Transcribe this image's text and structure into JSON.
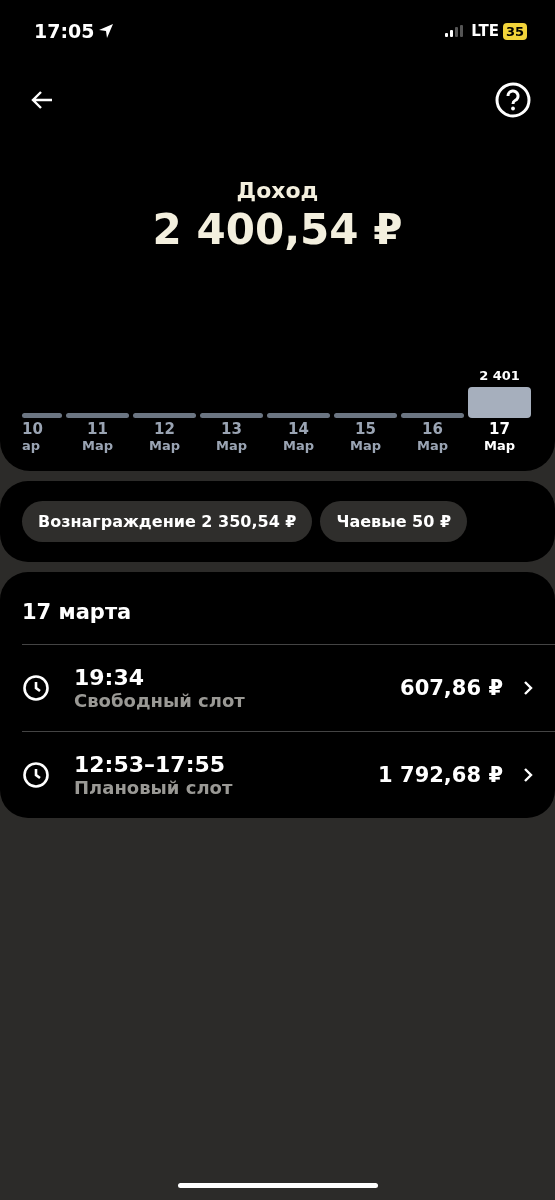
{
  "status_bar": {
    "time": "17:05",
    "network": "LTE",
    "battery": "35"
  },
  "header": {
    "title": "Доход",
    "amount": "2 400,54 ₽"
  },
  "days": [
    {
      "day": "10",
      "month": "ар",
      "selected": false
    },
    {
      "day": "11",
      "month": "Мар",
      "selected": false
    },
    {
      "day": "12",
      "month": "Мар",
      "selected": false
    },
    {
      "day": "13",
      "month": "Мар",
      "selected": false
    },
    {
      "day": "14",
      "month": "Мар",
      "selected": false
    },
    {
      "day": "15",
      "month": "Мар",
      "selected": false
    },
    {
      "day": "16",
      "month": "Мар",
      "selected": false
    },
    {
      "day": "17",
      "month": "Мар",
      "selected": true,
      "value": "2 401"
    }
  ],
  "chips": [
    "Вознаграждение 2 350,54 ₽",
    "Чаевые 50 ₽"
  ],
  "section": {
    "title": "17 марта",
    "rows": [
      {
        "time": "19:34",
        "type": "Свободный слот",
        "amount": "607,86 ₽"
      },
      {
        "time": "12:53–17:55",
        "type": "Плановый слот",
        "amount": "1 792,68 ₽"
      }
    ]
  }
}
